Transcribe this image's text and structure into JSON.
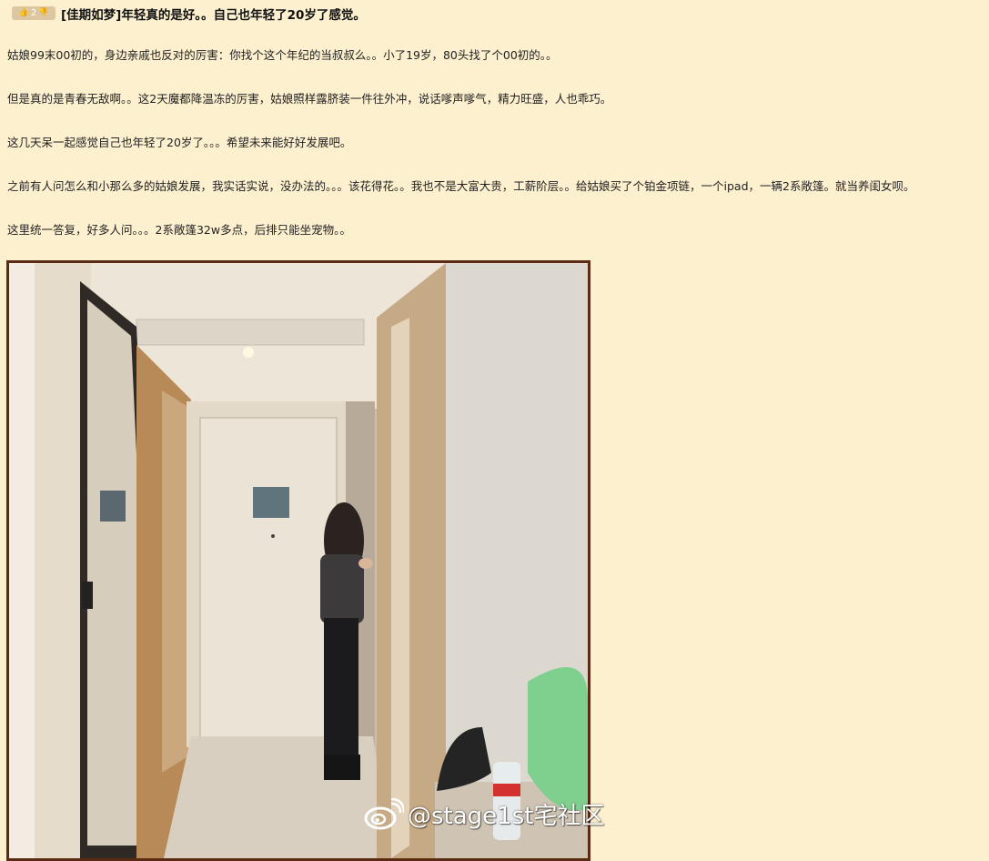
{
  "post": {
    "vote_count": "2",
    "title": "[佳期如梦]年轻真的是好。。自己也年轻了20岁了感觉。",
    "paragraphs": [
      "姑娘99末00初的，身边亲戚也反对的厉害：你找个这个年纪的当叔叔么。。小了19岁，80头找了个00初的。。",
      "但是真的是青春无敌啊。。这2天魔都降温冻的厉害，姑娘照样露脐装一件往外冲，说话嗲声嗲气，精力旺盛，人也乖巧。",
      "这几天呆一起感觉自己也年轻了20岁了。。。希望未来能好好发展吧。",
      "之前有人问怎么和小那么多的姑娘发展，我实话实说，没办法的。。。该花得花。。我也不是大富大贵，工薪阶层。。给姑娘买了个铂金项链，一个ipad，一辆2系敞篷。就当养闺女呗。",
      "这里统一答复，好多人问。。。2系敞篷32w多点，后排只能坐宠物。。"
    ]
  },
  "image": {
    "watermark": "@stage1st宅社区"
  },
  "icons": {
    "thumb_up": "thumbs-up-icon",
    "thumb_down": "thumbs-down-icon",
    "weibo": "weibo-logo-icon"
  },
  "colors": {
    "background": "#fdf0cf",
    "badge": "#dcc7a1",
    "photo_border": "#5a2a12"
  }
}
